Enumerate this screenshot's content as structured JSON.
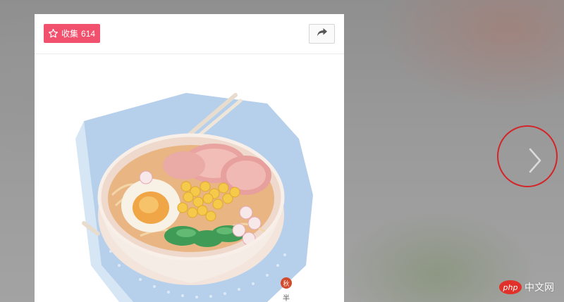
{
  "collect": {
    "label": "收集",
    "count": "614",
    "icon": "star-outline-icon",
    "color": "#f2516d"
  },
  "share": {
    "icon": "share-arrow-icon"
  },
  "artwork": {
    "subject": "ramen bowl illustration",
    "seal_text": "秋",
    "signature_text": "半"
  },
  "navigation": {
    "next_icon": "chevron-right-icon",
    "highlight_color": "#d42428"
  },
  "watermark": {
    "logo_text": "php",
    "site_text": "中文网"
  }
}
